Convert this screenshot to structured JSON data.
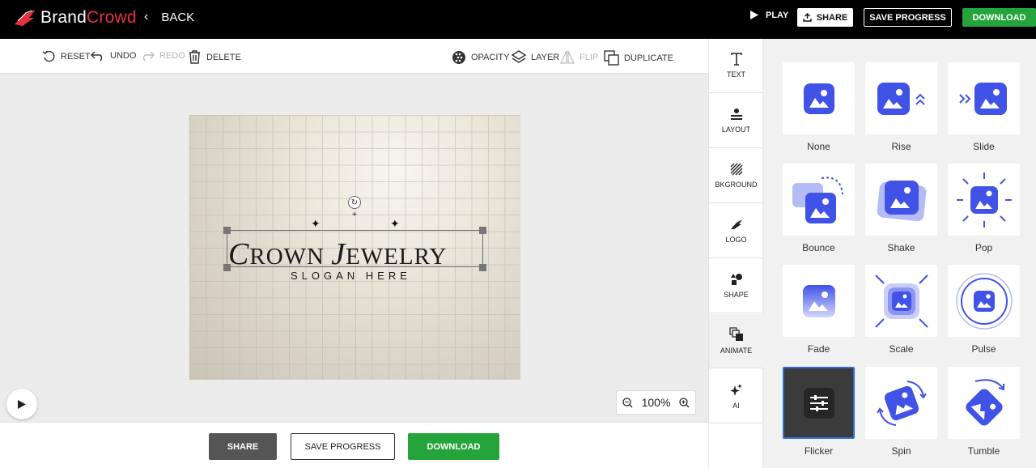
{
  "brand": {
    "name_part1": "Brand",
    "name_part2": "Crowd",
    "accent": "#e8313f"
  },
  "header": {
    "back_label": "BACK",
    "play_label": "PLAY",
    "share_label": "SHARE",
    "save_label": "SAVE PROGRESS",
    "download_label": "DOWNLOAD"
  },
  "toolbar": {
    "reset": "RESET",
    "undo": "UNDO",
    "redo": "REDO",
    "delete": "DELETE",
    "opacity": "OPACITY",
    "layer": "LAYER",
    "flip": "FLIP",
    "duplicate": "DUPLICATE"
  },
  "design": {
    "title": "ROWN EWELRY",
    "title_initial_1": "C",
    "title_word_1": "ROWN",
    "title_initial_2": "J",
    "title_word_2": "EWELRY",
    "slogan": "SLOGAN HERE"
  },
  "zoom": {
    "value": "100%"
  },
  "bottom": {
    "share_label": "SHARE",
    "save_label": "SAVE PROGRESS",
    "download_label": "DOWNLOAD"
  },
  "sidebar": {
    "items": [
      {
        "label": "TEXT",
        "icon": "text-icon"
      },
      {
        "label": "LAYOUT",
        "icon": "layout-icon"
      },
      {
        "label": "BKGROUND",
        "icon": "background-icon"
      },
      {
        "label": "LOGO",
        "icon": "logo-icon"
      },
      {
        "label": "SHAPE",
        "icon": "shape-icon"
      },
      {
        "label": "ANIMATE",
        "icon": "animate-icon",
        "active": true
      },
      {
        "label": "AI",
        "icon": "ai-sparkle-icon"
      }
    ]
  },
  "animations": [
    {
      "label": "None"
    },
    {
      "label": "Rise"
    },
    {
      "label": "Slide"
    },
    {
      "label": "Bounce"
    },
    {
      "label": "Shake"
    },
    {
      "label": "Pop"
    },
    {
      "label": "Fade"
    },
    {
      "label": "Scale"
    },
    {
      "label": "Pulse"
    },
    {
      "label": "Flicker",
      "selected": true
    },
    {
      "label": "Spin"
    },
    {
      "label": "Tumble"
    }
  ],
  "colors": {
    "accent_blue": "#4152e6",
    "green": "#26a43c",
    "topbar": "#000000"
  }
}
